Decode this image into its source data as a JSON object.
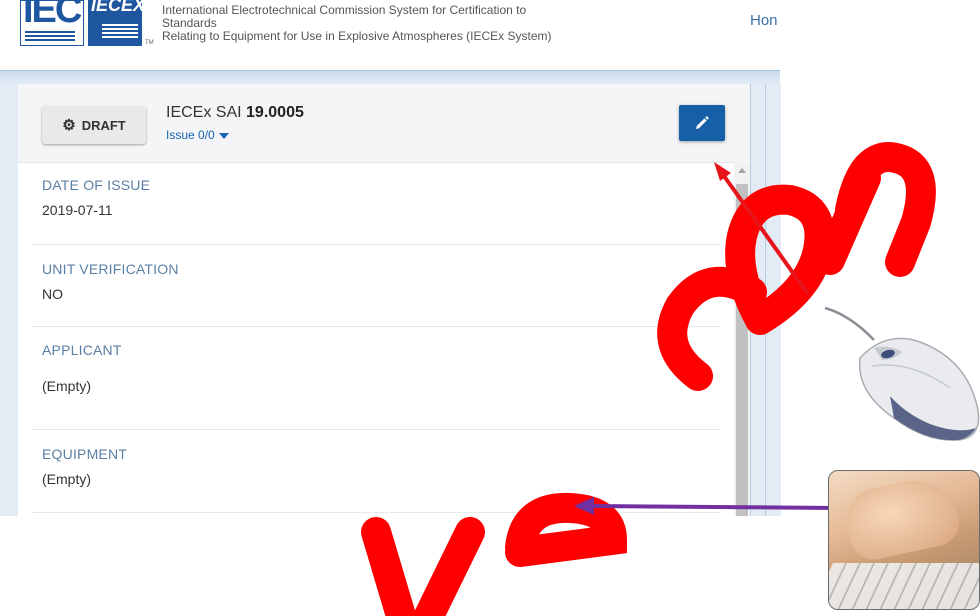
{
  "header": {
    "logo_iec_text": "IEC",
    "logo_iecex_text": "IECEX",
    "tm": "TM",
    "org_line1": "International Electrotechnical Commission System for Certification to",
    "org_line2": "Standards",
    "org_line3": "Relating to Equipment for Use in Explosive Atmospheres (IECEx System)",
    "nav_home": "Hon"
  },
  "card": {
    "status_button": "DRAFT",
    "status_icon": "gear-icon",
    "cert_prefix": "IECEx SAI",
    "cert_number": "19.0005",
    "issue_label": "Issue 0/0",
    "edit_icon": "pencil-icon",
    "edit_button_color": "#1760a8"
  },
  "fields": [
    {
      "label": "DATE OF ISSUE",
      "value": "2019-07-11"
    },
    {
      "label": "UNIT VERIFICATION",
      "value": "NO"
    },
    {
      "label": "APPLICANT",
      "value": "(Empty)"
    },
    {
      "label": "EQUIPMENT",
      "value": "(Empty)"
    }
  ],
  "overlay": {
    "watermark_color": "#ff0000",
    "arrow_click_color": "#e8141b",
    "arrow_type_color": "#7030a0",
    "mouse_image": "computer-mouse",
    "keyboard_image": "hands-typing-on-keyboard"
  }
}
